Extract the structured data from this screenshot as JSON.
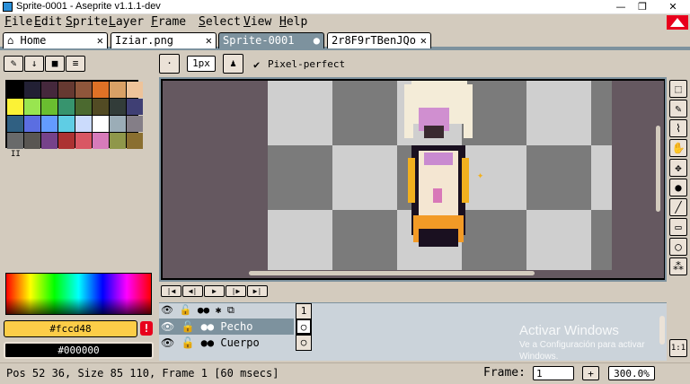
{
  "window": {
    "title": "Sprite-0001 - Aseprite v1.1.1-dev",
    "min": "—",
    "max": "❐",
    "close": "✕"
  },
  "menu": [
    {
      "accel": "F",
      "rest": "ile"
    },
    {
      "accel": "E",
      "rest": "dit"
    },
    {
      "accel": "S",
      "rest": "prite"
    },
    {
      "accel": "L",
      "rest": "ayer"
    },
    {
      "accel": "F",
      "rest": "rame"
    },
    {
      "accel": "S",
      "rest": "elect"
    },
    {
      "accel": "V",
      "rest": "iew"
    },
    {
      "accel": "H",
      "rest": "elp"
    }
  ],
  "tabs": [
    {
      "label": "Home",
      "close": "✕",
      "icon": "home-icon"
    },
    {
      "label": "Iziar.png",
      "close": "✕"
    },
    {
      "label": "Sprite-0001",
      "close": "●",
      "active": true
    },
    {
      "label": "2r8F9rTBenJQo",
      "close": "✕"
    }
  ],
  "context": {
    "brush_size": "1px",
    "pixel_perfect": "Pixel-perfect",
    "check": "✔"
  },
  "palette": [
    "#000000",
    "#222034",
    "#45283c",
    "#663931",
    "#8f563b",
    "#df7126",
    "#d9a066",
    "#eec39a",
    "#fbf236",
    "#99e550",
    "#6abe30",
    "#37946e",
    "#4b692f",
    "#524b24",
    "#323c39",
    "#3f3f74",
    "#306082",
    "#5b6ee1",
    "#639bff",
    "#5fcde4",
    "#cbdbfc",
    "#ffffff",
    "#9badb7",
    "#847e87",
    "#696a6a",
    "#595652",
    "#76428a",
    "#ac3232",
    "#d95763",
    "#d77bba",
    "#8f974a",
    "#8a6f30"
  ],
  "palette_marker": "II",
  "colors": {
    "fg": "#fccd48",
    "bg": "#000000",
    "fg_label": "#fccd48",
    "bg_label": "#000000",
    "warning": "!"
  },
  "timeline": {
    "frame_number": "1",
    "layers": [
      {
        "name": "Pecho",
        "selected": true
      },
      {
        "name": "Cuerpo",
        "selected": false
      }
    ]
  },
  "watermark": {
    "title": "Activar Windows",
    "line": "Ve a Configuración para activar",
    "line2": "Windows."
  },
  "status": {
    "text": "Pos 52 36, Size 85 110, Frame 1 [60 msecs]",
    "frame_label": "Frame:",
    "frame_value": "1",
    "plus": "+",
    "zoom": "300.0%"
  },
  "toolbar_bottom": "1:1"
}
